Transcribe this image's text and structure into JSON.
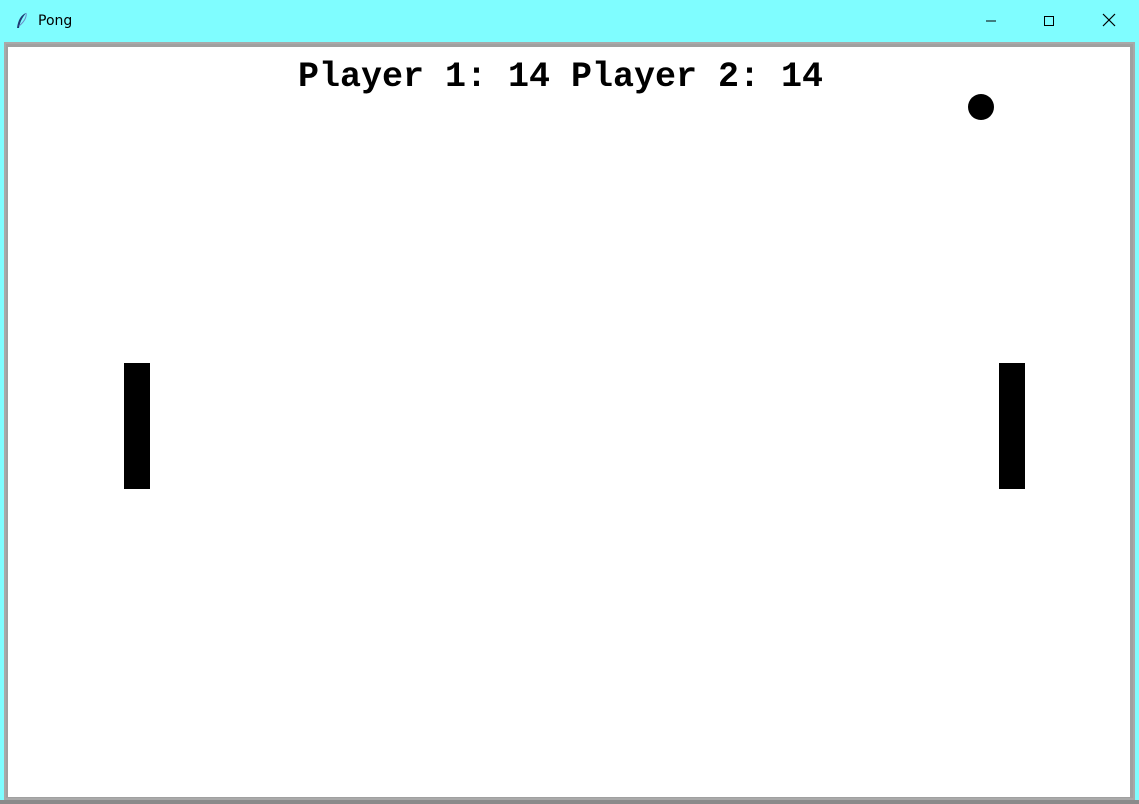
{
  "window": {
    "title": "Pong",
    "icon": "feather-icon",
    "titlebar_color": "#7ffdff",
    "controls": {
      "minimize_icon": "minimize-icon",
      "maximize_icon": "maximize-icon",
      "close_icon": "close-icon"
    }
  },
  "game": {
    "score_text": "Player 1: 14 Player 2: 14",
    "player1_score": 14,
    "player2_score": 14,
    "background_color": "#ffffff",
    "foreground_color": "#000000"
  }
}
